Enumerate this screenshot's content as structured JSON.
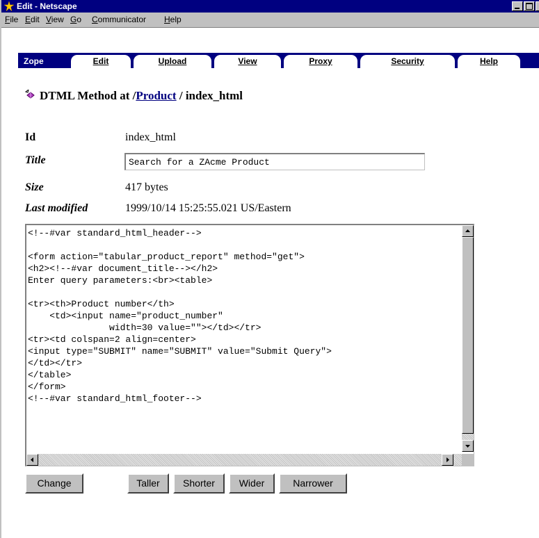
{
  "window": {
    "title": "Edit - Netscape"
  },
  "menubar": {
    "items": [
      {
        "key": "F",
        "rest": "ile"
      },
      {
        "key": "E",
        "rest": "dit"
      },
      {
        "key": "V",
        "rest": "iew"
      },
      {
        "key": "G",
        "rest": "o"
      },
      {
        "key": "C",
        "rest": "ommunicator"
      },
      {
        "key": "H",
        "rest": "elp"
      }
    ]
  },
  "tabs": {
    "brand": "Zope",
    "items": [
      "Edit",
      "Upload",
      "View",
      "Proxy",
      "Security",
      "Help"
    ],
    "active": "Edit"
  },
  "heading": {
    "prefix": "DTML Method at /",
    "link": "Product",
    "suffix": " / index_html"
  },
  "properties": {
    "id_label": "Id",
    "id_value": "index_html",
    "title_label": "Title",
    "title_value": "Search for a ZAcme Product",
    "size_label": "Size",
    "size_value": "417 bytes",
    "modified_label": "Last modified",
    "modified_value": "1999/10/14 15:25:55.021 US/Eastern"
  },
  "editor": {
    "content": "<!--#var standard_html_header-->\n\n<form action=\"tabular_product_report\" method=\"get\">\n<h2><!--#var document_title--></h2>\nEnter query parameters:<br><table>\n\n<tr><th>Product number</th>\n    <td><input name=\"product_number\"\n               width=30 value=\"\"></td></tr>\n<tr><td colspan=2 align=center>\n<input type=\"SUBMIT\" name=\"SUBMIT\" value=\"Submit Query\">\n</td></tr>\n</table>\n</form>\n<!--#var standard_html_footer-->"
  },
  "buttons": {
    "change": "Change",
    "taller": "Taller",
    "shorter": "Shorter",
    "wider": "Wider",
    "narrower": "Narrower"
  }
}
